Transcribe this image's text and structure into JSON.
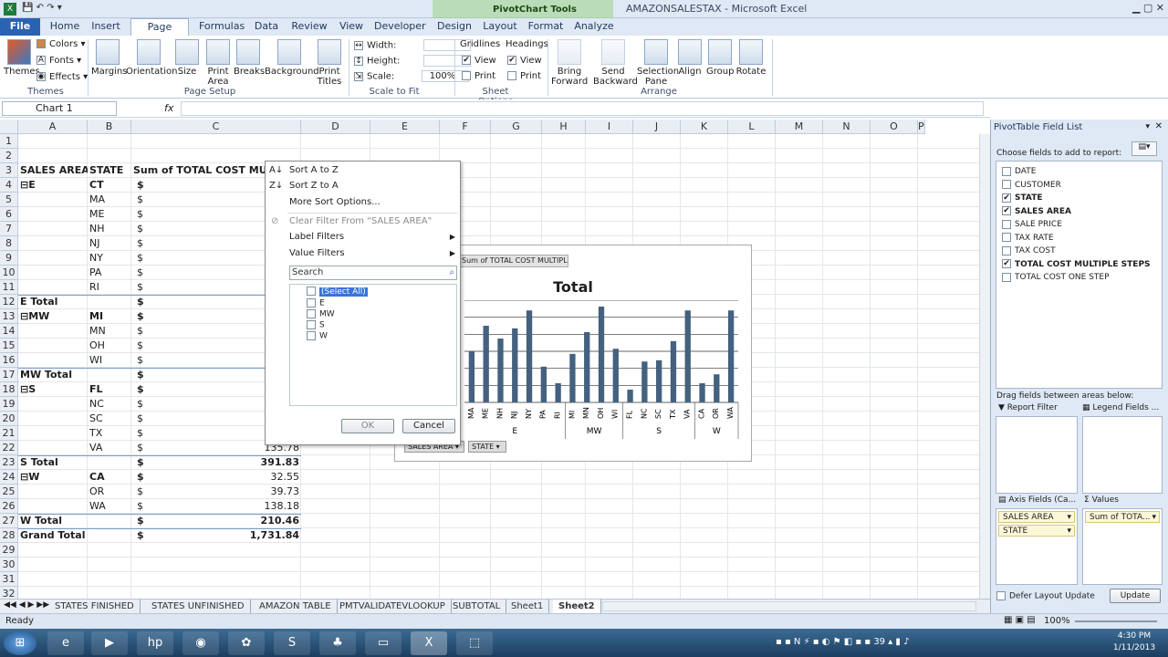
{
  "titlebar": {
    "title": "AMAZONSALESTAX  -  Microsoft Excel",
    "context_label": "PivotChart Tools"
  },
  "tabs": [
    "File",
    "Home",
    "Insert",
    "Page Layout",
    "Formulas",
    "Data",
    "Review",
    "View",
    "Developer",
    "Design",
    "Layout",
    "Format",
    "Analyze"
  ],
  "ribbon": {
    "themes": {
      "themes": "Themes",
      "colors": "Colors",
      "fonts": "Fonts",
      "effects": "Effects",
      "group": "Themes"
    },
    "page_setup": {
      "margins": "Margins",
      "orientation": "Orientation",
      "size": "Size",
      "print_area": "Print Area",
      "breaks": "Breaks",
      "background": "Background",
      "print_titles": "Print Titles",
      "group": "Page Setup"
    },
    "scale": {
      "width": "Width:",
      "height": "Height:",
      "scale": "Scale:",
      "scale_value": "100%",
      "group": "Scale to Fit"
    },
    "sheet_options": {
      "gridlines": "Gridlines",
      "headings": "Headings",
      "view": "View",
      "print": "Print",
      "group": "Sheet Options"
    },
    "arrange": {
      "bring_forward": "Bring Forward",
      "send_backward": "Send Backward",
      "selection_pane": "Selection Pane",
      "align": "Align",
      "group_btn": "Group",
      "rotate": "Rotate",
      "group": "Arrange"
    }
  },
  "formula": {
    "name_box": "Chart 1",
    "fx": "fx"
  },
  "columns": [
    "A",
    "B",
    "C",
    "D",
    "E",
    "F",
    "G",
    "H",
    "I",
    "J",
    "K",
    "L",
    "M",
    "N",
    "O",
    "P"
  ],
  "rows": [
    {
      "n": "1",
      "a": "",
      "b": "",
      "c": ""
    },
    {
      "n": "2",
      "a": "",
      "b": "",
      "c": ""
    },
    {
      "n": "3",
      "a": "SALES AREA",
      "b": "STATE",
      "c": "Sum of TOTAL COST MULTIPLE STEPS"
    },
    {
      "n": "4",
      "a": "⊟E",
      "b": "CT",
      "c": "$"
    },
    {
      "n": "5",
      "a": "",
      "b": "MA",
      "c": "$"
    },
    {
      "n": "6",
      "a": "",
      "b": "ME",
      "c": "$"
    },
    {
      "n": "7",
      "a": "",
      "b": "NH",
      "c": "$"
    },
    {
      "n": "8",
      "a": "",
      "b": "NJ",
      "c": "$"
    },
    {
      "n": "9",
      "a": "",
      "b": "NY",
      "c": "$"
    },
    {
      "n": "10",
      "a": "",
      "b": "PA",
      "c": "$"
    },
    {
      "n": "11",
      "a": "",
      "b": "RI",
      "c": "$"
    },
    {
      "n": "12",
      "a": "E Total",
      "b": "",
      "c": "$"
    },
    {
      "n": "13",
      "a": "⊟MW",
      "b": "MI",
      "c": "$"
    },
    {
      "n": "14",
      "a": "",
      "b": "MN",
      "c": "$"
    },
    {
      "n": "15",
      "a": "",
      "b": "OH",
      "c": "$"
    },
    {
      "n": "16",
      "a": "",
      "b": "WI",
      "c": "$"
    },
    {
      "n": "17",
      "a": "MW Total",
      "b": "",
      "c": "$"
    },
    {
      "n": "18",
      "a": "⊟S",
      "b": "FL",
      "c": "$"
    },
    {
      "n": "19",
      "a": "",
      "b": "NC",
      "c": "$"
    },
    {
      "n": "20",
      "a": "",
      "b": "SC",
      "c": "$"
    },
    {
      "n": "21",
      "a": "",
      "b": "TX",
      "c": "$"
    },
    {
      "n": "22",
      "a": "",
      "b": "VA",
      "c": "$",
      "v": "135.78"
    },
    {
      "n": "23",
      "a": "S Total",
      "b": "",
      "c": "$",
      "v": "391.83"
    },
    {
      "n": "24",
      "a": "⊟W",
      "b": "CA",
      "c": "$",
      "v": "32.55"
    },
    {
      "n": "25",
      "a": "",
      "b": "OR",
      "c": "$",
      "v": "39.73"
    },
    {
      "n": "26",
      "a": "",
      "b": "WA",
      "c": "$",
      "v": "138.18"
    },
    {
      "n": "27",
      "a": "W Total",
      "b": "",
      "c": "$",
      "v": "210.46"
    },
    {
      "n": "28",
      "a": "Grand Total",
      "b": "",
      "c": "$",
      "v": "1,731.84"
    },
    {
      "n": "29",
      "a": "",
      "b": "",
      "c": ""
    },
    {
      "n": "30",
      "a": "",
      "b": "",
      "c": ""
    },
    {
      "n": "31",
      "a": "",
      "b": "",
      "c": ""
    },
    {
      "n": "32",
      "a": "",
      "b": "",
      "c": ""
    }
  ],
  "filter_menu": {
    "sort_az": "Sort A to Z",
    "sort_za": "Sort Z to A",
    "more_sort": "More Sort Options...",
    "clear_filter": "Clear Filter From \"SALES AREA\"",
    "label_filters": "Label Filters",
    "value_filters": "Value Filters",
    "search_placeholder": "Search",
    "items": [
      "(Select All)",
      "E",
      "MW",
      "S",
      "W"
    ],
    "ok": "OK",
    "cancel": "Cancel"
  },
  "chart_data": {
    "type": "bar",
    "title": "Total",
    "field_button": "Sum of TOTAL COST MULTIPLE STEPS",
    "categories": [
      "MA",
      "ME",
      "NH",
      "NJ",
      "NY",
      "PA",
      "RI",
      "MI",
      "MN",
      "OH",
      "WI",
      "FL",
      "NC",
      "SC",
      "TX",
      "VA",
      "CA",
      "OR",
      "WA"
    ],
    "values": [
      40,
      60,
      50,
      58,
      72,
      28,
      15,
      38,
      55,
      75,
      42,
      10,
      32,
      33,
      48,
      72,
      15,
      22,
      72
    ],
    "groups": [
      {
        "name": "E",
        "span": 7
      },
      {
        "name": "MW",
        "span": 4
      },
      {
        "name": "S",
        "span": 5
      },
      {
        "name": "W",
        "span": 3
      }
    ],
    "axis_buttons": [
      "SALES AREA",
      "STATE"
    ]
  },
  "sheets": [
    "STATES FINISHED",
    "STATES UNFINISHED",
    "AMAZON TABLE",
    "PMTVALIDATEVLOOKUP",
    "SUBTOTAL",
    "Sheet1",
    "Sheet2"
  ],
  "status": {
    "ready": "Ready",
    "zoom": "100%"
  },
  "field_list": {
    "title": "PivotTable Field List",
    "choose": "Choose fields to add to report:",
    "fields": [
      {
        "name": "DATE",
        "checked": false
      },
      {
        "name": "CUSTOMER",
        "checked": false
      },
      {
        "name": "STATE",
        "checked": true
      },
      {
        "name": "SALES AREA",
        "checked": true
      },
      {
        "name": "SALE PRICE",
        "checked": false
      },
      {
        "name": "TAX RATE",
        "checked": false
      },
      {
        "name": "TAX COST",
        "checked": false
      },
      {
        "name": "TOTAL COST MULTIPLE STEPS",
        "checked": true
      },
      {
        "name": "TOTAL COST ONE STEP",
        "checked": false
      }
    ],
    "drag": "Drag fields between areas below:",
    "report_filter": "Report Filter",
    "legend_fields": "Legend Fields ...",
    "axis_fields": "Axis Fields (Ca...",
    "values": "Values",
    "axis_items": [
      "SALES AREA",
      "STATE"
    ],
    "value_items": [
      "Sum of TOTA..."
    ],
    "defer": "Defer Layout Update",
    "update": "Update"
  },
  "taskbar": {
    "time": "4:30 PM",
    "date": "1/11/2013"
  },
  "colors": {
    "bar": "#44617f",
    "accent": "#2a62b4"
  }
}
